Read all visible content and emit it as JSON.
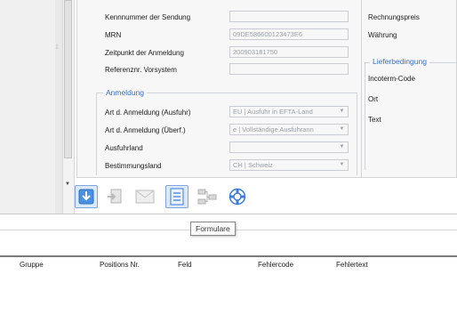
{
  "sendung": {
    "kennnummer": {
      "label": "Kennnummer der Sendung",
      "value": ""
    },
    "mrn": {
      "label": "MRN",
      "value": "09DE586600123473E6"
    },
    "zeitpunkt": {
      "label": "Zeitpunkt der Anmeldung",
      "value": "200903181750"
    },
    "referenz": {
      "label": "Referenznr. Vorsystem",
      "value": ""
    }
  },
  "anmeldung": {
    "group_title": "Anmeldung",
    "ausfuhr": {
      "label": "Art d. Anmeldung (Ausfuhr)",
      "value": "EU | Ausfuhr in EFTA-Land"
    },
    "ueberf": {
      "label": "Art d. Anmeldung (Überf.)",
      "value": "e | Vollständige Ausfuhrann"
    },
    "ausfuhrland": {
      "label": "Ausfuhrland",
      "value": ""
    },
    "bestimmungsland": {
      "label": "Bestimmungsland",
      "value": "CH | Schweiz"
    }
  },
  "right_panel": {
    "rechnungspreis": "Rechnungspreis",
    "waehrung": "Währung",
    "lieferbedingung_title": "Lieferbedingung",
    "incoterm": "Incoterm-Code",
    "ort": "Ort",
    "text": "Text"
  },
  "toolbar": {
    "tooltip": "Formulare",
    "buttons": [
      "down-arrow-icon",
      "import-icon",
      "mail-icon",
      "form-icon",
      "tree-icon",
      "help-lifebuoy-icon"
    ]
  },
  "error_table": {
    "columns": [
      "Gruppe",
      "Positions Nr.",
      "Feld",
      "Fehlercode",
      "Fehlertext"
    ]
  },
  "colors": {
    "accent": "#3b7dd8",
    "group_title": "#3a6fc4",
    "border": "#c9cdd3"
  }
}
